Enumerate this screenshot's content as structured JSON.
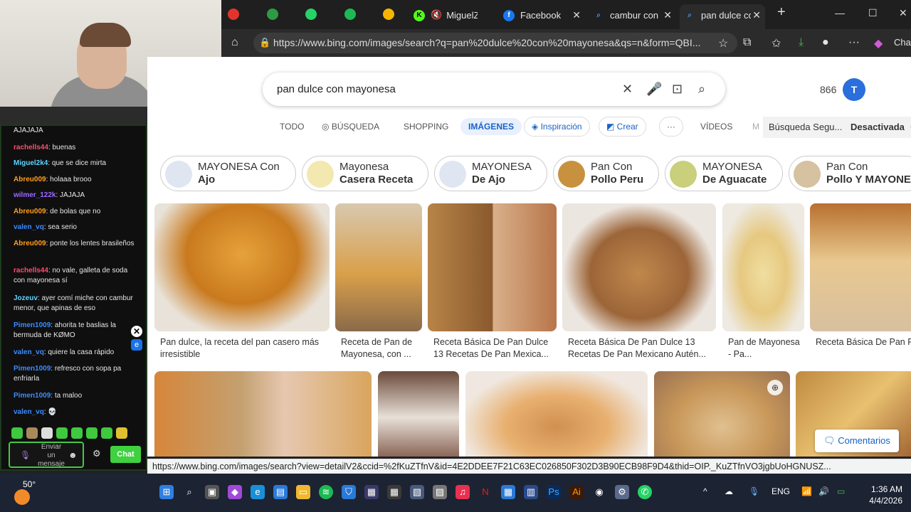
{
  "chat": {
    "messages": [
      {
        "user": "",
        "text": "AJAJAJA",
        "color": "#e6e6e6"
      },
      {
        "user": "rachells44",
        "text": ": buenas",
        "color": "#ff4d6a"
      },
      {
        "user": "Miguel2k4",
        "text": ": que se dice mirta",
        "color": "#5fd3ff"
      },
      {
        "user": "Abreu009",
        "text": ": holaaa brooo",
        "color": "#ff9f1a"
      },
      {
        "user": "wilmer_122k",
        "text": ": JAJAJA",
        "color": "#9c6bff"
      },
      {
        "user": "Abreu009",
        "text": ": de bolas que no",
        "color": "#ff9f1a"
      },
      {
        "user": "valen_vq",
        "text": ": sea serio",
        "color": "#3b8cff"
      },
      {
        "user": "Abreu009",
        "text": ": ponte los lentes brasileños",
        "color": "#ff9f1a"
      },
      {
        "user": "rachells44",
        "text": ": no vale, galleta de soda con mayonesa sí",
        "color": "#ff4d6a"
      },
      {
        "user": "Jozeuv",
        "text": ": ayer comí miche con cambur menor, que apinas de eso",
        "color": "#5fd3ff"
      },
      {
        "user": "Pimen1009",
        "text": ": ahorita te baslias la bermuda de KØMO",
        "color": "#3b8cff"
      },
      {
        "user": "valen_vq",
        "text": ": quiere la casa rápido",
        "color": "#3b8cff"
      },
      {
        "user": "Pimen1009",
        "text": ": refresco con sopa pa enfriarla",
        "color": "#3b8cff"
      },
      {
        "user": "Pimen1009",
        "text": ": ta maloo",
        "color": "#3b8cff"
      },
      {
        "user": "valen_vq",
        "text": ": 💀",
        "color": "#3b8cff"
      }
    ],
    "input_placeholder": "Enviar un mensaje",
    "send_label": "Chat"
  },
  "tabs": [
    {
      "title": "MiguelZ",
      "icon": "kick-icon",
      "color": "#53fc18"
    },
    {
      "title": "Facebook",
      "icon": "facebook-icon",
      "color": "#1877f2"
    },
    {
      "title": "cambur con",
      "icon": "search-icon",
      "color": "#4a90e2"
    },
    {
      "title": "pan dulce co",
      "icon": "search-icon",
      "color": "#4a90e2"
    }
  ],
  "address": {
    "url": "https://www.bing.com/images/search?q=pan%20dulce%20con%20mayonesa&qs=n&form=QBI...",
    "chat_label": "Chat"
  },
  "search": {
    "query": "pan dulce con mayonesa",
    "points": "866"
  },
  "nav": {
    "todo": "TODO",
    "busqueda": "BÚSQUEDA",
    "shopping": "SHOPPING",
    "imagenes": "IMÁGENES",
    "inspiracion": "Inspiración",
    "crear": "Crear",
    "more": "···",
    "videos": "VÍDEOS",
    "partial": "M",
    "safe_label": "Búsqueda Segu...",
    "safe_value": "Desactivada"
  },
  "chips": [
    {
      "line1": "MAYONESA Con",
      "line2": "Ajo"
    },
    {
      "line1": "Mayonesa",
      "line2": "Casera Receta"
    },
    {
      "line1": "MAYONESA",
      "line2": "De Ajo"
    },
    {
      "line1": "Pan Con",
      "line2": "Pollo Peru"
    },
    {
      "line1": "MAYONESA",
      "line2": "De Aguacate"
    },
    {
      "line1": "Pan Con",
      "line2": "Pollo Y MAYONE"
    }
  ],
  "results": [
    {
      "caption": "Pan dulce, la receta del pan casero más irresistible"
    },
    {
      "caption": "Receta de Pan de Mayonesa, con ..."
    },
    {
      "caption": "Receta Básica De Pan Dulce 13 Recetas De Pan Mexica..."
    },
    {
      "caption": "Receta Básica De Pan Dulce 13 Recetas De Pan Mexicano Autén..."
    },
    {
      "caption": "Pan de Mayonesa - Pa..."
    },
    {
      "caption": "Receta Básica De Pan Recetas De Pan Mexic"
    }
  ],
  "feedback_label": "Comentarios",
  "status_url": "https://www.bing.com/images/search?view=detailV2&ccid=%2fKuZTfnV&id=4E2DDEE7F21C63EC026850F302D3B90ECB98F9D4&thid=OIP._KuZTfnVO3jgbUoHGNUSZ...",
  "taskbar": {
    "temp": "50°",
    "lang": "ENG",
    "time": "1:36 AM",
    "date": "4/4/2026"
  }
}
